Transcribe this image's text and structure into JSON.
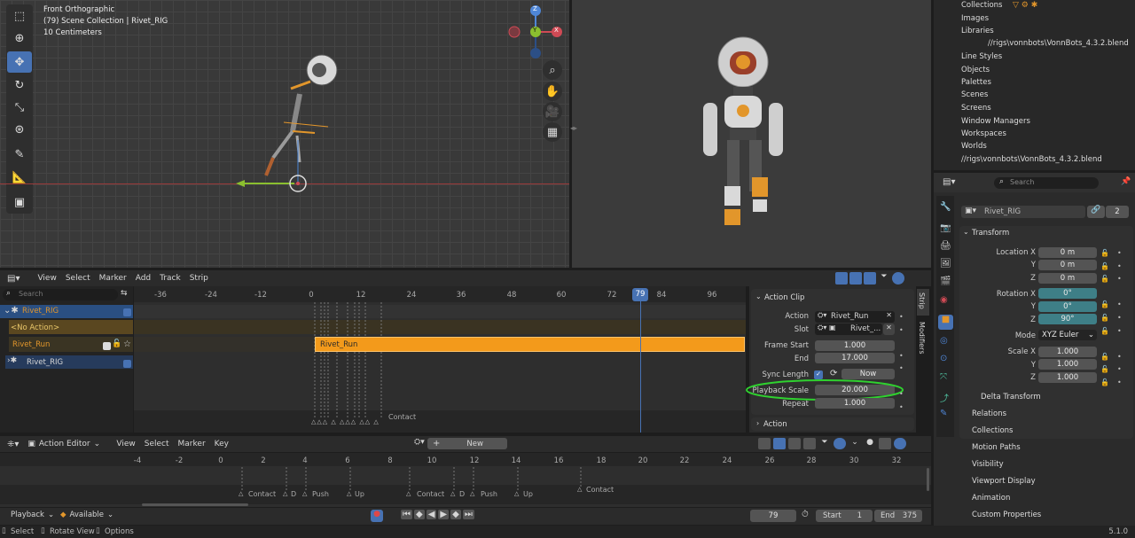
{
  "viewport_left": {
    "view_name": "Front Orthographic",
    "collection": "(79) Scene Collection | Rivet_RIG",
    "scale": "10 Centimeters",
    "gizmo": {
      "z": "Z",
      "y": "Y",
      "x": "X"
    }
  },
  "nla": {
    "menu": [
      "View",
      "Select",
      "Marker",
      "Add",
      "Track",
      "Strip"
    ],
    "search_placeholder": "Search",
    "ruler": [
      "-36",
      "-24",
      "-12",
      "0",
      "12",
      "24",
      "36",
      "48",
      "60",
      "72",
      "84",
      "96"
    ],
    "current_frame": "79",
    "tracks": {
      "rig": "Rivet_RIG",
      "no_action": "<No Action>",
      "run": "Rivet_Run",
      "rig2": "Rivet_RIG"
    },
    "strip_label": "Rivet_Run",
    "marker_label": "Contact",
    "side_tabs": [
      "Strip",
      "Modifiers"
    ],
    "panel": {
      "title": "Action Clip",
      "action_label": "Action",
      "action_value": "Rivet_Run",
      "slot_label": "Slot",
      "slot_value": "Rivet_...",
      "frame_start_label": "Frame Start",
      "frame_start": "1.000",
      "end_label": "End",
      "end": "17.000",
      "sync_label": "Sync Length",
      "now_label": "Now",
      "playback_label": "Playback Scale",
      "playback_value": "20.000",
      "repeat_label": "Repeat",
      "repeat": "1.000",
      "action_section": "Action"
    }
  },
  "action_editor": {
    "mode": "Action Editor",
    "menu": [
      "View",
      "Select",
      "Marker",
      "Key"
    ],
    "new_label": "New",
    "ruler": [
      "-4",
      "-2",
      "0",
      "2",
      "4",
      "6",
      "8",
      "10",
      "12",
      "14",
      "16",
      "18",
      "20",
      "22",
      "24",
      "26",
      "28",
      "30",
      "32"
    ],
    "markers": [
      "Contact",
      "D",
      "Push",
      "Up",
      "Contact",
      "D",
      "Push",
      "Up",
      "Contact"
    ]
  },
  "timeline": {
    "playback": "Playback",
    "sync": "Available",
    "current": "79",
    "start_label": "Start",
    "start": "1",
    "end_label": "End",
    "end": "375"
  },
  "status": {
    "select": "Select",
    "rotate": "Rotate View",
    "options": "Options",
    "version": "5.1.0"
  },
  "outliner": {
    "items": [
      "Collections",
      "Images",
      "Libraries",
      "//rigs\\vonnbots\\VonnBots_4.3.2.blend",
      "Line Styles",
      "Objects",
      "Palettes",
      "Scenes",
      "Screens",
      "Window Managers",
      "Workspaces",
      "Worlds",
      "//rigs\\vonnbots\\VonnBots_4.3.2.blend"
    ]
  },
  "properties": {
    "search_placeholder": "Search",
    "object_name": "Rivet_RIG",
    "users": "2",
    "transform_title": "Transform",
    "location": {
      "label": "Location X",
      "y_label": "Y",
      "z_label": "Z",
      "x": "0 m",
      "y": "0 m",
      "z": "0 m"
    },
    "rotation": {
      "label": "Rotation X",
      "y_label": "Y",
      "z_label": "Z",
      "x": "0°",
      "y": "0°",
      "z": "90°"
    },
    "mode_label": "Mode",
    "mode_value": "XYZ Euler",
    "scale": {
      "label": "Scale X",
      "y_label": "Y",
      "z_label": "Z",
      "x": "1.000",
      "y": "1.000",
      "z": "1.000"
    },
    "sections": [
      "Delta Transform",
      "Relations",
      "Collections",
      "Motion Paths",
      "Visibility",
      "Viewport Display",
      "Animation",
      "Custom Properties"
    ]
  },
  "colors": {
    "accent": "#4772b3",
    "strip": "#f39a1b",
    "highlight_circle": "#2fd12f",
    "teal": "#3e7f87"
  }
}
